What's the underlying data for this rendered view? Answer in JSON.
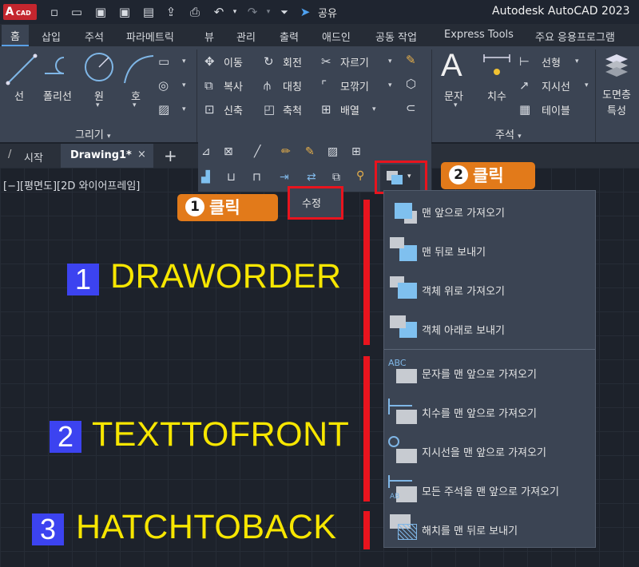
{
  "app": {
    "logo_letter": "A",
    "logo_text": "CAD",
    "title": "Autodesk AutoCAD 2023",
    "share_label": "공유"
  },
  "ribbon_tabs": [
    "홈",
    "삽입",
    "주석",
    "파라메트릭",
    "뷰",
    "관리",
    "출력",
    "애드인",
    "공동 작업",
    "Express Tools",
    "주요 응용프로그램"
  ],
  "draw_panel": {
    "tools": [
      "선",
      "폴리선",
      "원",
      "호"
    ],
    "title": "그리기"
  },
  "modify_panel": {
    "rows": [
      [
        "이동",
        "회전",
        "자르기"
      ],
      [
        "복사",
        "대칭",
        "모깎기"
      ],
      [
        "신축",
        "축척",
        "배열"
      ]
    ],
    "title": "수정"
  },
  "annotation_panel": {
    "big_tools": [
      "문자",
      "치수"
    ],
    "small_tools": [
      "선형",
      "지시선",
      "테이블"
    ],
    "title": "주석"
  },
  "layer_panel": {
    "label_line1": "도면층",
    "label_line2": "특성"
  },
  "doc_tabs": {
    "start": "시작",
    "active": "Drawing1*",
    "close": "×",
    "add": "+"
  },
  "viewport_label": "[−][평면도][2D 와이어프레임]",
  "callouts": [
    {
      "number": "1",
      "text": "클릭"
    },
    {
      "number": "2",
      "text": "클릭"
    }
  ],
  "draworder_menu": {
    "group1": [
      "맨 앞으로 가져오기",
      "맨 뒤로 보내기",
      "객체 위로 가져오기",
      "객체 아래로 보내기"
    ],
    "group2": [
      "문자를 맨 앞으로 가져오기",
      "치수를 맨 앞으로 가져오기",
      "지시선을 맨 앞으로 가져오기",
      "모든 주석을 맨 앞으로 가져오기"
    ],
    "group3": [
      "해치를 맨 뒤로 보내기"
    ]
  },
  "commands": [
    {
      "number": "1",
      "name": "DRAWORDER"
    },
    {
      "number": "2",
      "name": "TEXTTOFRONT"
    },
    {
      "number": "3",
      "name": "HATCHTOBACK"
    }
  ],
  "colors": {
    "accent_red": "#e8141e",
    "callout_orange": "#e27a1a",
    "command_yellow": "#f7e600",
    "number_blue": "#3c43f0"
  }
}
